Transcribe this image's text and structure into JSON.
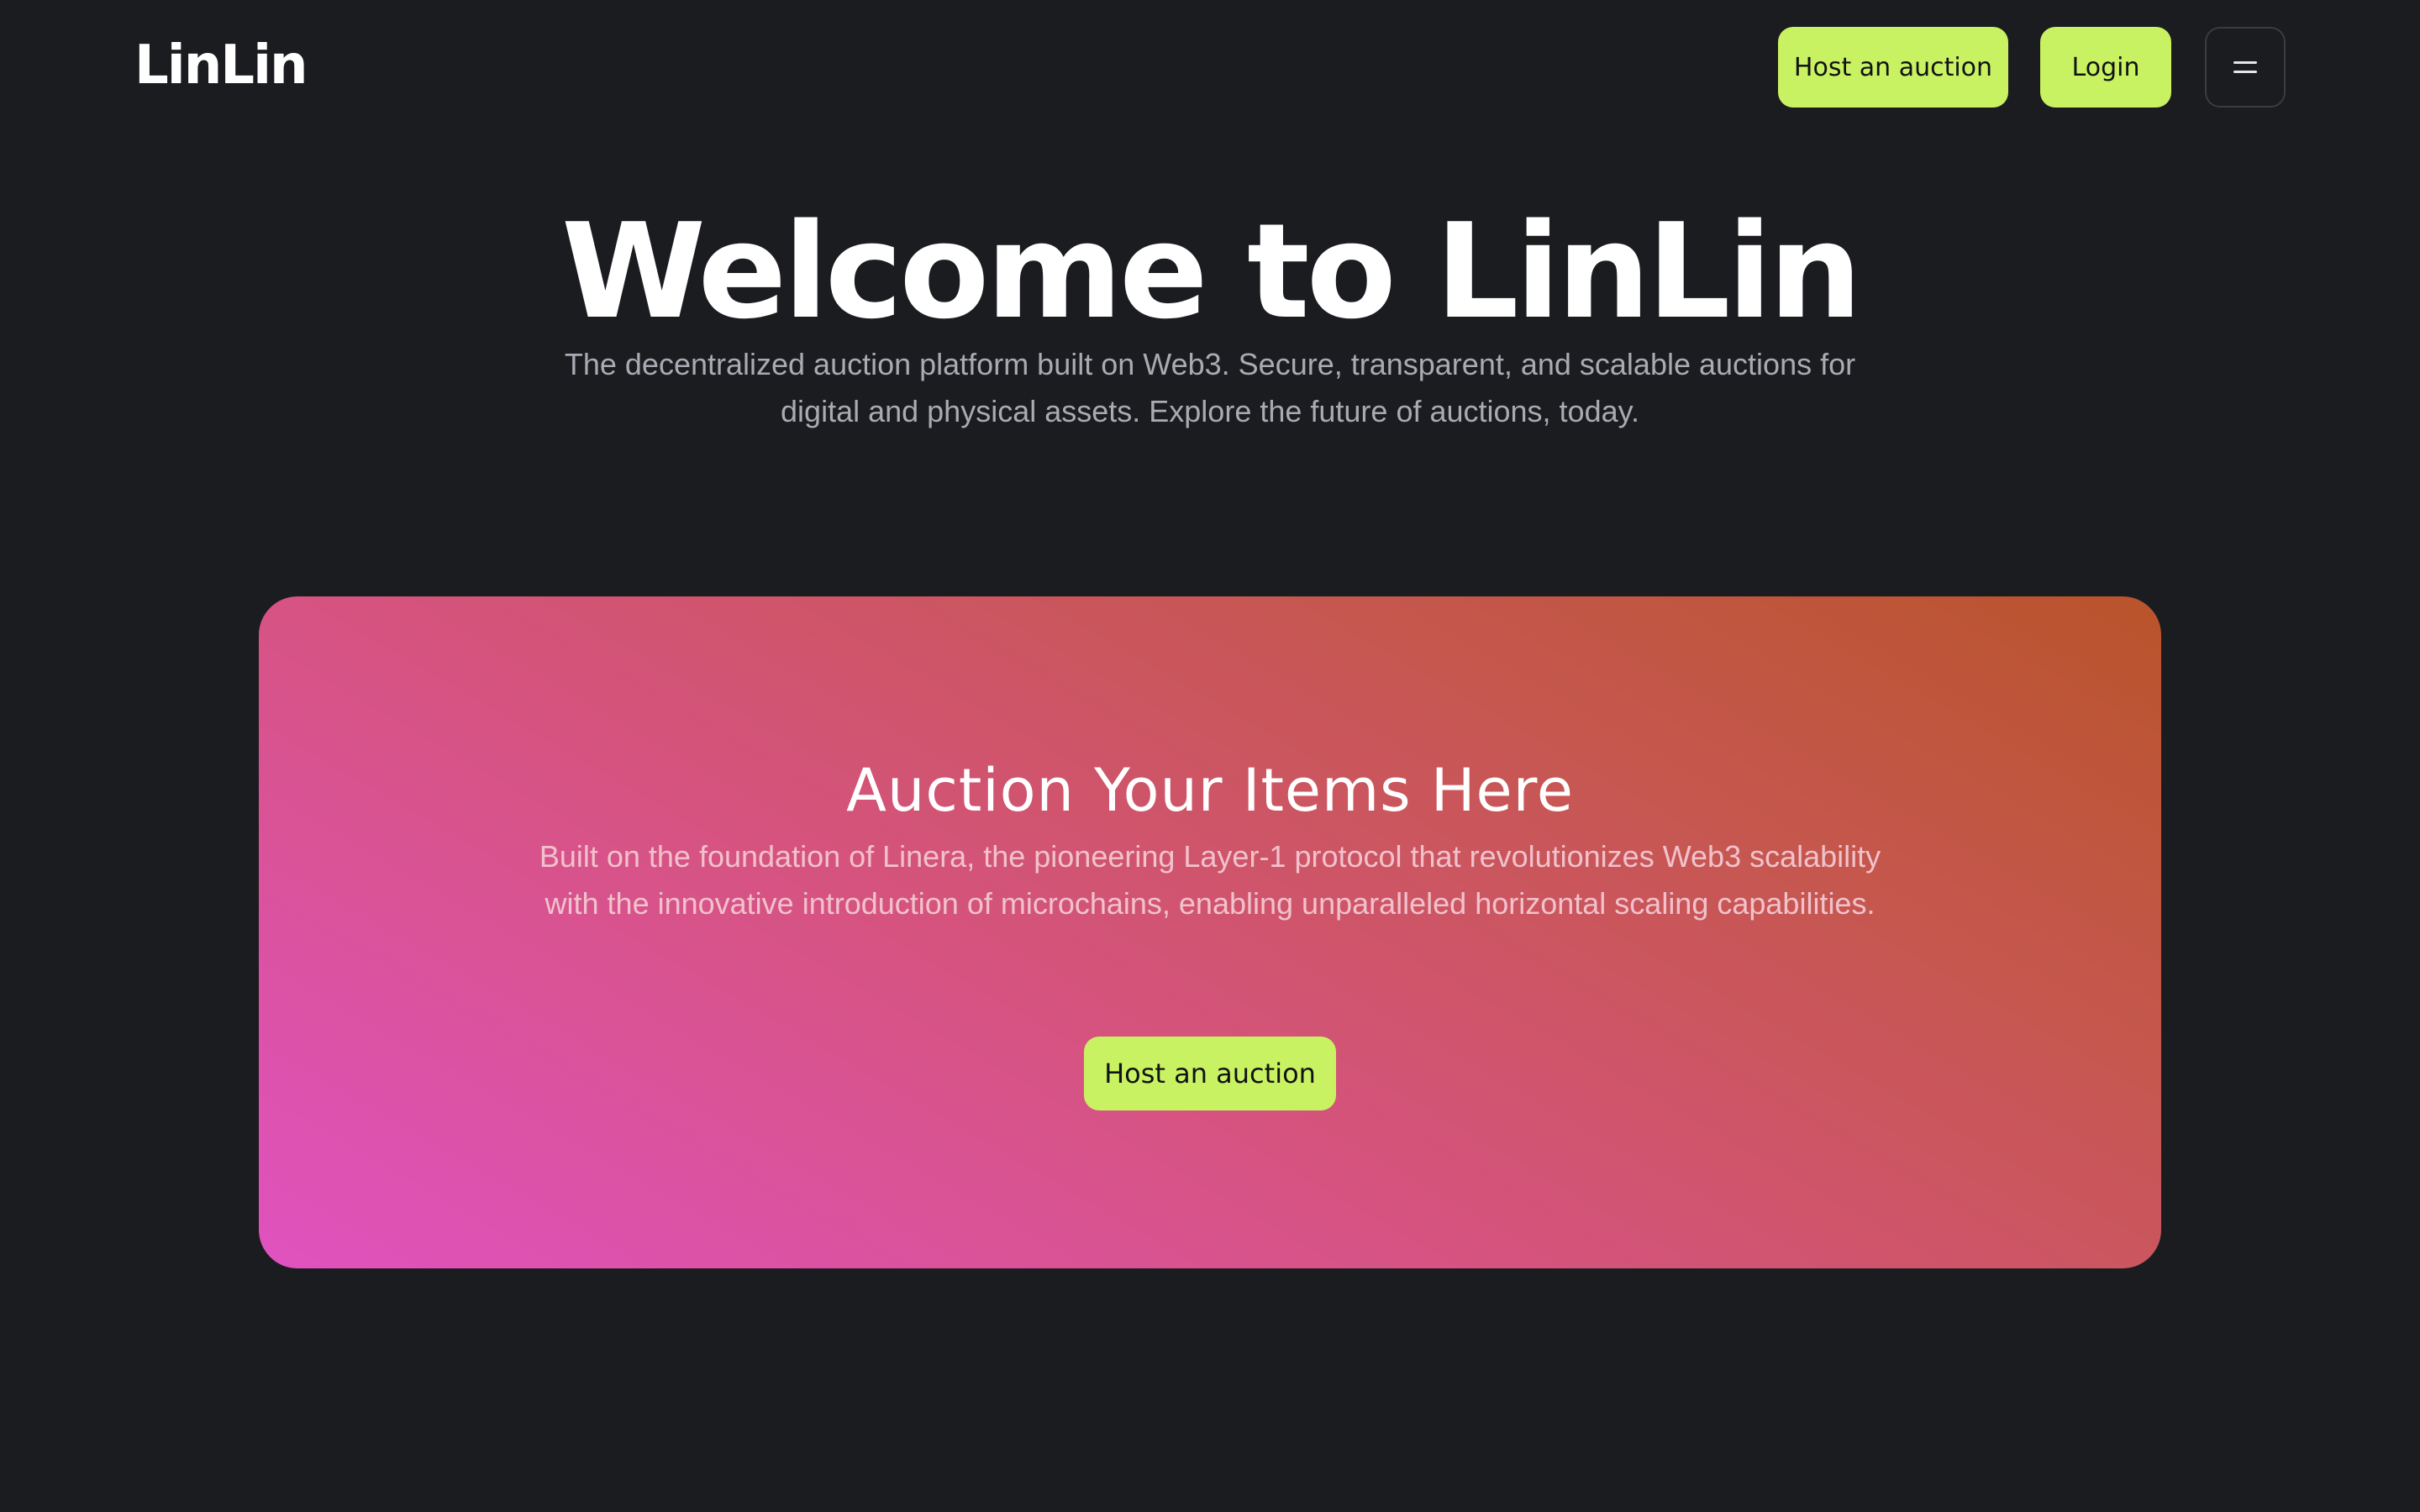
{
  "header": {
    "logo": "LinLin",
    "host_button": "Host an auction",
    "login_button": "Login",
    "menu_icon": "hamburger-menu-icon"
  },
  "hero": {
    "title": "Welcome to LinLin",
    "subtitle": "The decentralized auction platform built on Web3. Secure, transparent, and scalable auctions for digital and physical assets. Explore the future of auctions, today."
  },
  "promo": {
    "title": "Auction Your Items Here",
    "text": "Built on the foundation of Linera, the pioneering Layer-1 protocol that revolutionizes Web3 scalability with the innovative introduction of microchains, enabling unparalleled horizontal scaling capabilities.",
    "button": "Host an auction"
  },
  "colors": {
    "background": "#1b1c20",
    "accent": "#c9f262",
    "gradient_start": "#e052bf",
    "gradient_end": "#b9542b"
  }
}
